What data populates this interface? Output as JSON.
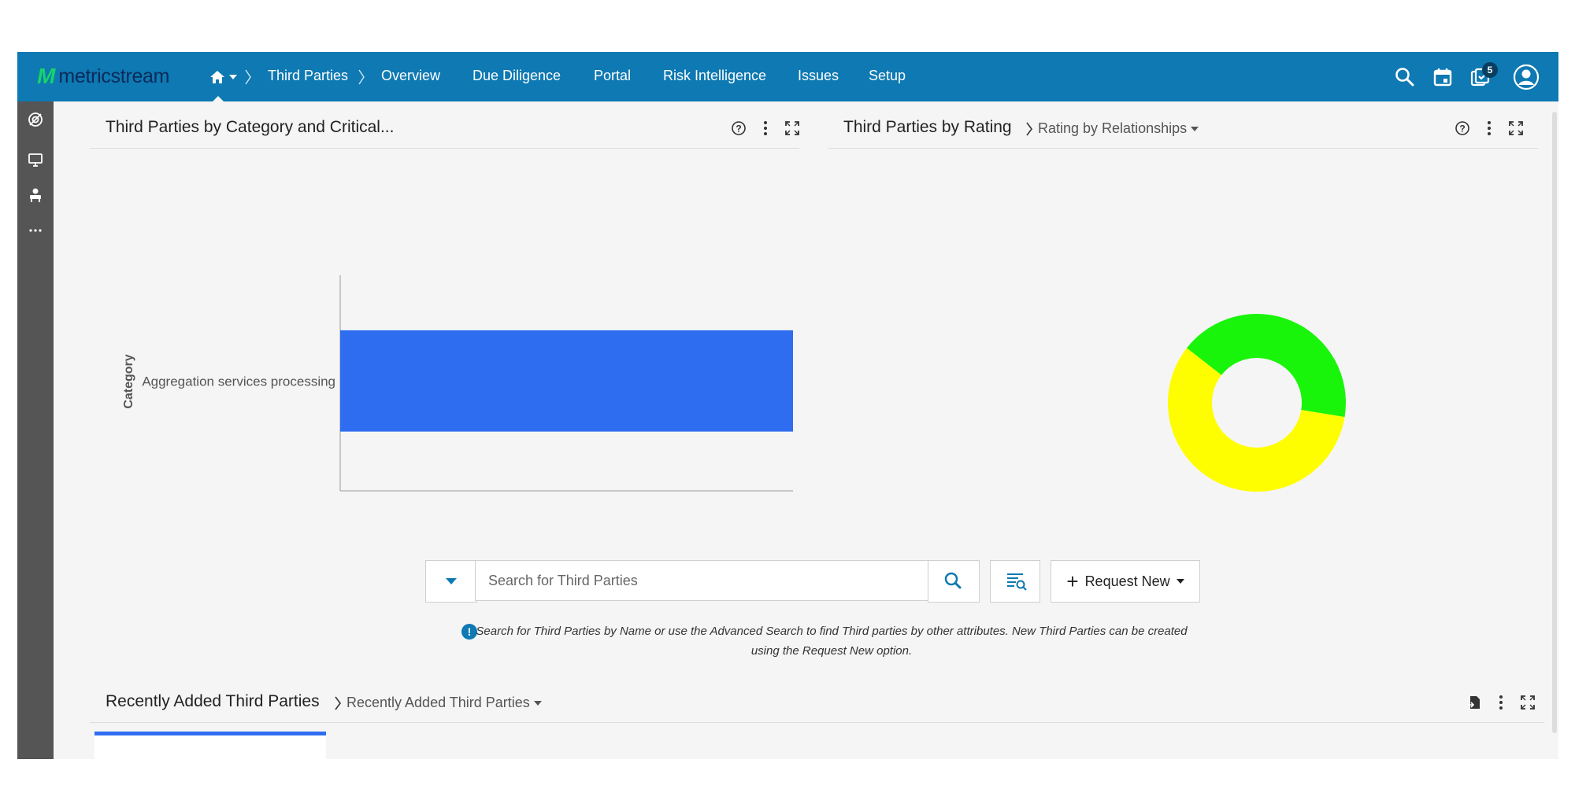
{
  "brand": {
    "name": "metricstream",
    "accent": "#0e79b2",
    "logo_mark_color": "#16d36a"
  },
  "nav": {
    "items": [
      {
        "label": "Third Parties"
      },
      {
        "label": "Overview"
      },
      {
        "label": "Due Diligence"
      },
      {
        "label": "Portal"
      },
      {
        "label": "Risk Intelligence"
      },
      {
        "label": "Issues"
      },
      {
        "label": "Setup"
      }
    ],
    "icons": [
      "home-icon",
      "search-icon",
      "calendar-icon",
      "tasks-icon",
      "user-icon"
    ],
    "tasks_badge": "5"
  },
  "sidebar": {
    "icons": [
      "target-icon",
      "monitor-icon",
      "user-desk-icon",
      "more-icon"
    ]
  },
  "category_panel": {
    "title": "Third Parties by Category and Critical...",
    "icons": [
      "help-icon",
      "kebab-icon",
      "expand-icon"
    ]
  },
  "rating_panel": {
    "title": "Third Parties by Rating",
    "view": "Rating by Relationships",
    "icons": [
      "help-icon",
      "kebab-icon",
      "expand-icon"
    ]
  },
  "chart_data": [
    {
      "type": "bar",
      "orientation": "horizontal",
      "ylabel": "Category",
      "categories": [
        "Aggregation services processing"
      ],
      "values": [
        1
      ],
      "colors": [
        "#2f6df0"
      ]
    },
    {
      "type": "pie",
      "variant": "donut",
      "slices": [
        {
          "value": 0.42,
          "color": "#19f50a"
        },
        {
          "value": 0.58,
          "color": "#fffe00"
        }
      ]
    }
  ],
  "search": {
    "placeholder": "Search for Third Parties",
    "request_label": "Request New",
    "info_text": "Search for Third Parties by Name or use the Advanced Search to find Third parties by other attributes. New Third Parties can be created using the Request New option."
  },
  "recent_panel": {
    "title": "Recently Added Third Parties",
    "view": "Recently Added Third Parties",
    "icons": [
      "export-icon",
      "kebab-icon",
      "expand-icon"
    ]
  }
}
